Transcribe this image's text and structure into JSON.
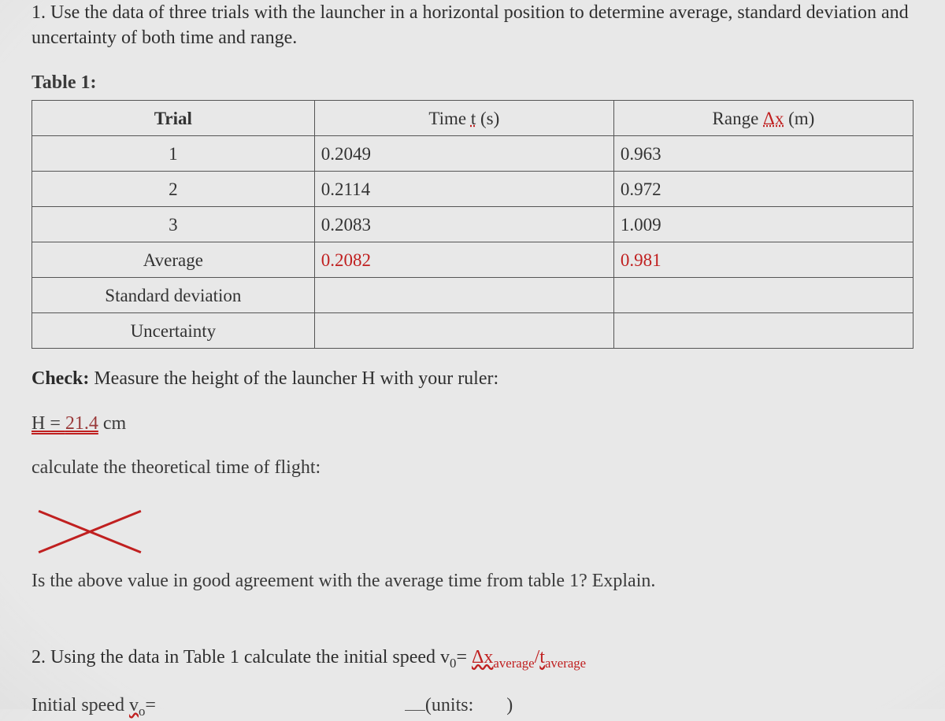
{
  "q1_text": "1. Use the data of three trials with the launcher in a horizontal position to determine average, standard deviation and uncertainty of both time and range.",
  "table_label": "Table 1:",
  "headers": {
    "trial": "Trial",
    "time_full": "Time t (s)",
    "time_pre": "Time ",
    "time_t": "t",
    "time_s": " (s)",
    "range_pre": "Range ",
    "range_dx": "Δx",
    "range_m": " (m)"
  },
  "rows": [
    {
      "trial": "1",
      "time": "0.2049",
      "range": "0.963"
    },
    {
      "trial": "2",
      "time": "0.2114",
      "range": "0.972"
    },
    {
      "trial": "3",
      "time": "0.2083",
      "range": "1.009"
    },
    {
      "trial": "Average",
      "time": "0.2082",
      "range": "0.981",
      "avg": true
    },
    {
      "trial": "Standard deviation",
      "time": "",
      "range": ""
    },
    {
      "trial": "Uncertainty",
      "time": "",
      "range": ""
    }
  ],
  "check_bold": "Check:",
  "check_rest": " Measure the height of the launcher H with your ruler:",
  "h_pre": "H = ",
  "h_val": "21.4",
  "h_unit": " cm",
  "calc_line": "calculate the theoretical time of flight:",
  "agree_line": "Is the above value in good agreement with the average time from table 1? Explain.",
  "q2_pre": "2. Using the data in Table 1 calculate the initial speed v",
  "q2_sub0": "0",
  "q2_eq": "= ",
  "q2_dx": "Δx",
  "q2_dx_sub": "average",
  "q2_slash": "/",
  "q2_t": "t",
  "q2_t_sub": "average",
  "isp_label_pre": "Initial speed ",
  "isp_v": "v",
  "isp_sub": "o",
  "isp_eq": "=",
  "units_label": "(units:",
  "units_close": ")"
}
